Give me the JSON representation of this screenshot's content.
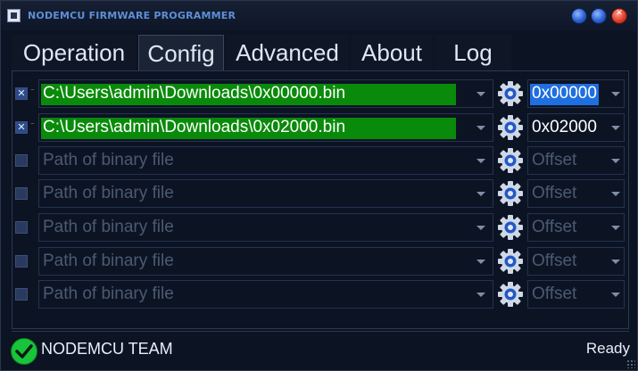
{
  "window": {
    "title": "NODEMCU FIRMWARE PROGRAMMER",
    "controls": {
      "minimize_icon": "circle-blue",
      "maximize_icon": "circle-blue",
      "close_icon": "x"
    }
  },
  "tabs": [
    {
      "label": "Operation",
      "active": false
    },
    {
      "label": "Config",
      "active": true
    },
    {
      "label": "Advanced",
      "active": false
    },
    {
      "label": "About",
      "active": false
    },
    {
      "label": "Log",
      "active": false
    }
  ],
  "rows": [
    {
      "checked": true,
      "path": "C:\\Users\\admin\\Downloads\\0x00000.bin",
      "offset": "0x00000",
      "offset_selected": true,
      "filled": true
    },
    {
      "checked": true,
      "path": "C:\\Users\\admin\\Downloads\\0x02000.bin",
      "offset": "0x02000",
      "offset_selected": false,
      "filled": true
    },
    {
      "checked": false,
      "path": "Path of binary file",
      "offset": "Offset",
      "offset_selected": false,
      "filled": false
    },
    {
      "checked": false,
      "path": "Path of binary file",
      "offset": "Offset",
      "offset_selected": false,
      "filled": false
    },
    {
      "checked": false,
      "path": "Path of binary file",
      "offset": "Offset",
      "offset_selected": false,
      "filled": false
    },
    {
      "checked": false,
      "path": "Path of binary file",
      "offset": "Offset",
      "offset_selected": false,
      "filled": false
    },
    {
      "checked": false,
      "path": "Path of binary file",
      "offset": "Offset",
      "offset_selected": false,
      "filled": false
    }
  ],
  "status": {
    "team": "NODEMCU TEAM",
    "state": "Ready"
  },
  "colors": {
    "path_fill": "#0a8a0a",
    "offset_selected": "#1f6fe0",
    "status_ok": "#18c43a"
  }
}
